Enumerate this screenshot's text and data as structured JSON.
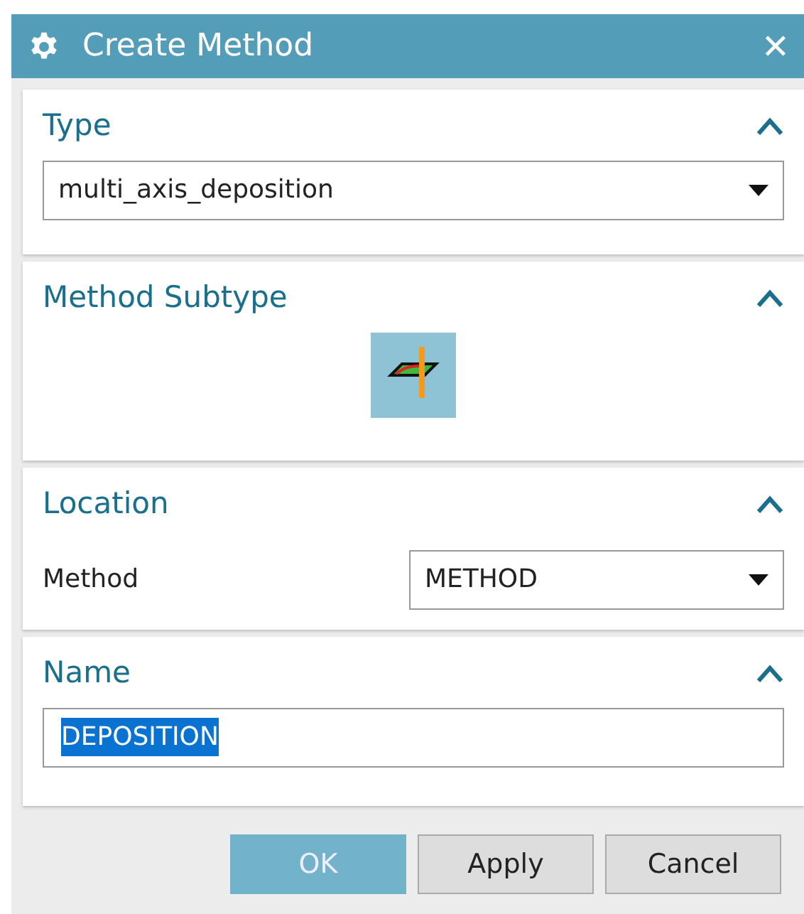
{
  "window": {
    "title": "Create Method",
    "close": "✕"
  },
  "sections": [
    {
      "kind": "dropdown",
      "title": "Type",
      "expanded": true,
      "value": "multi_axis_deposition"
    },
    {
      "kind": "subtypes",
      "title": "Method Subtype",
      "expanded": true,
      "items": [
        {
          "selected": true
        }
      ]
    },
    {
      "kind": "labeled_dropdown",
      "title": "Location",
      "expanded": true,
      "label": "Method",
      "value": "METHOD"
    },
    {
      "kind": "text_input",
      "title": "Name",
      "expanded": true,
      "value": "DEPOSITION",
      "text_selected": true
    }
  ],
  "buttons": [
    {
      "label": "OK",
      "default": true
    },
    {
      "label": "Apply",
      "default": false
    },
    {
      "label": "Cancel",
      "default": false
    }
  ]
}
